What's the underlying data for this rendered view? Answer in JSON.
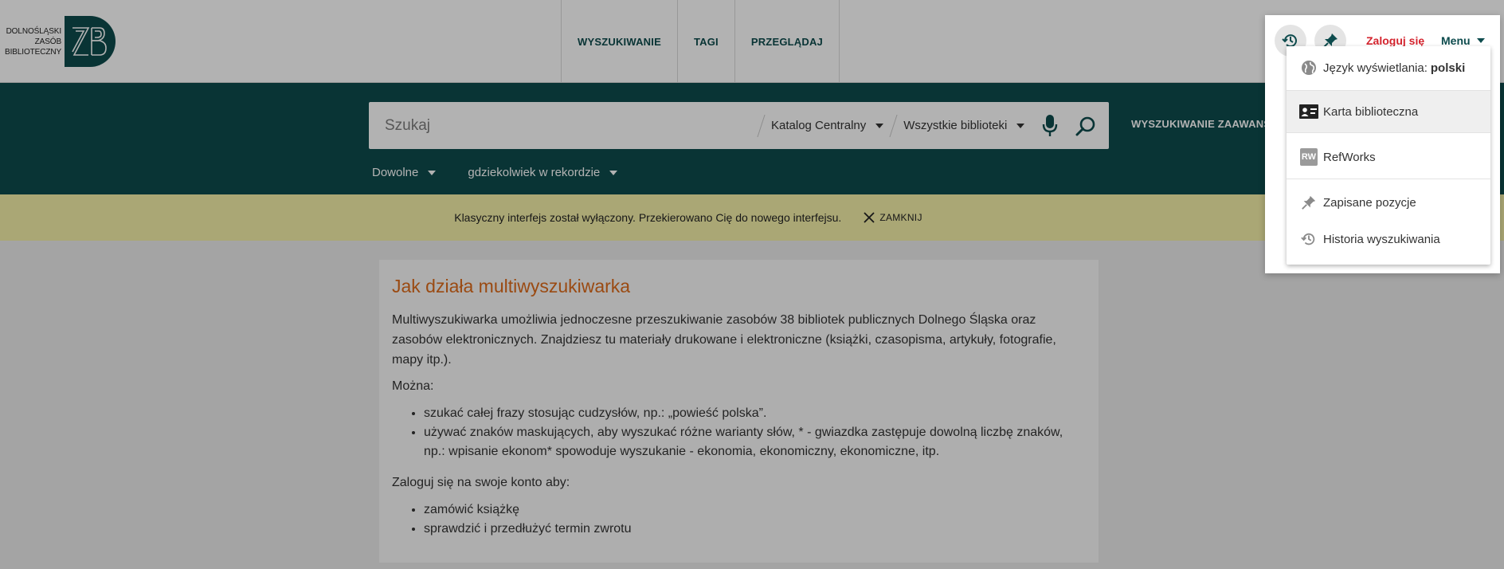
{
  "logo": {
    "lines": [
      "DOLNOŚLĄSKI",
      "ZASÓB",
      "BIBLIOTECZNY"
    ]
  },
  "topnav": [
    {
      "label": "WYSZUKIWANIE"
    },
    {
      "label": "TAGI"
    },
    {
      "label": "PRZEGLĄDAJ"
    }
  ],
  "user": {
    "login_label": "Zaloguj się",
    "menu_label": "Menu"
  },
  "search": {
    "placeholder": "Szukaj",
    "scope_label": "Katalog Centralny",
    "library_label": "Wszystkie biblioteki",
    "advanced_label": "WYSZUKIWANIE ZAAWANSOWANE",
    "filter_type": "Dowolne",
    "filter_field": "gdziekolwiek w rekordzie"
  },
  "notice": {
    "text": "Klasyczny interfejs został wyłączony. Przekierowano Cię do nowego interfejsu.",
    "close_label": "ZAMKNIJ"
  },
  "content": {
    "title": "Jak działa multiwyszukiwarka",
    "intro": "Multiwyszukiwarka umożliwia jednoczesne przeszukiwanie zasobów 38 bibliotek publicznych Dolnego Śląska oraz zasobów elektronicznych. Znajdziesz tu materiały drukowane i elektroniczne (książki, czasopisma, artykuły, fotografie, mapy itp.).",
    "can_label": "Można:",
    "can_items": [
      "szukać całej frazy stosując cudzysłów, np.: „powieść polska”.",
      "używać znaków maskujących, aby wyszukać różne warianty słów, * - gwiazdka zastępuje dowolną liczbę znaków, np.: wpisanie ekonom* spowoduje wyszukanie - ekonomia, ekonomiczny, ekonomiczne, itp."
    ],
    "login_label": "Zaloguj się na swoje konto aby:",
    "login_items": [
      "zamówić książkę",
      "sprawdzić i przedłużyć termin zwrotu"
    ]
  },
  "menu": {
    "language_label": "Język wyświetlania:",
    "language_value": "polski",
    "items": [
      {
        "label": "Karta biblioteczna",
        "icon": "library-card-icon"
      },
      {
        "label": "RefWorks",
        "icon": "refworks-icon",
        "badge": "RW"
      },
      {
        "label": "Zapisane pozycje",
        "icon": "pin-icon"
      },
      {
        "label": "Historia wyszukiwania",
        "icon": "history-icon"
      }
    ]
  },
  "colors": {
    "brand": "#0d4b4d",
    "accent": "#dd6a1a",
    "login": "#d4232d",
    "notice_bg": "#f4f0a8"
  }
}
